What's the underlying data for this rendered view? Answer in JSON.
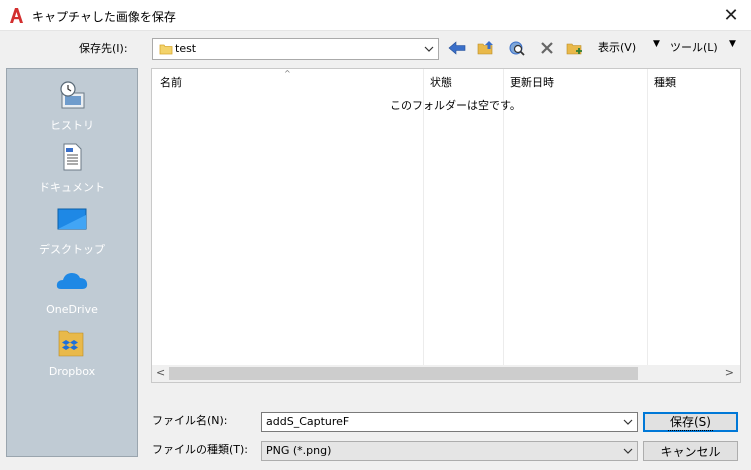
{
  "window": {
    "title": "キャプチャした画像を保存",
    "close": "✕"
  },
  "toolbar": {
    "save_in_label": "保存先(I):",
    "folder": "test",
    "view_menu": "表示(V)",
    "tools_menu": "ツール(L)",
    "icons": [
      "back-arrow-icon",
      "up-folder-icon",
      "search-web-icon",
      "delete-icon",
      "new-folder-icon"
    ]
  },
  "places": [
    {
      "label": "ヒストリ",
      "icon": "history-icon"
    },
    {
      "label": "ドキュメント",
      "icon": "documents-icon"
    },
    {
      "label": "デスクトップ",
      "icon": "desktop-icon"
    },
    {
      "label": "OneDrive",
      "icon": "onedrive-icon"
    },
    {
      "label": "Dropbox",
      "icon": "dropbox-icon"
    }
  ],
  "filelist": {
    "columns": [
      "名前",
      "状態",
      "更新日時",
      "種類"
    ],
    "empty_message": "このフォルダーは空です。"
  },
  "form": {
    "filename_label": "ファイル名(N):",
    "filename_value": "addS_CaptureF",
    "filetype_label": "ファイルの種類(T):",
    "filetype_value": "PNG (*.png)",
    "save_button": "保存(S)",
    "cancel_button": "キャンセル"
  },
  "colors": {
    "places_bg": "#c0cbd4",
    "accent": "#0078d7",
    "app_icon": "#d32f2f"
  }
}
